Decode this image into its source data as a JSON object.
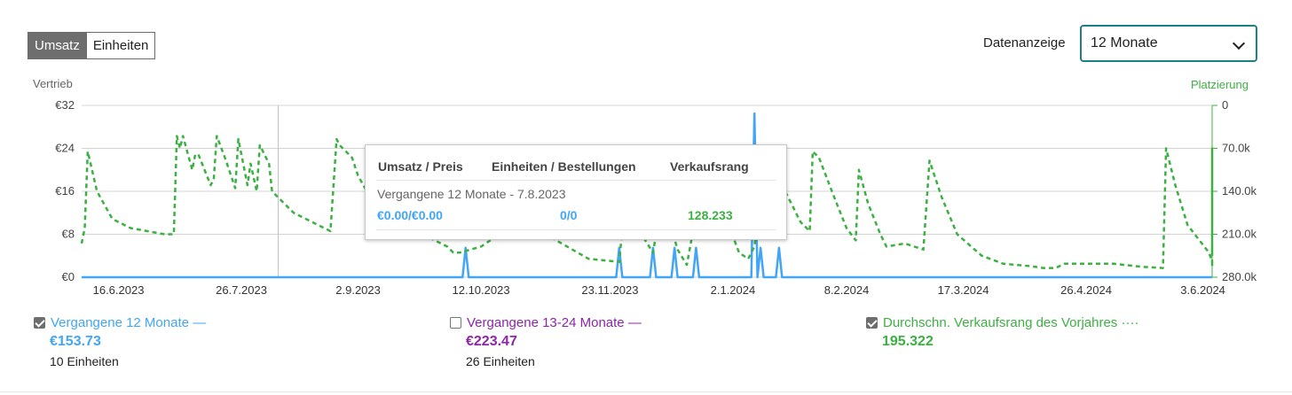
{
  "toggle": {
    "revenue": "Umsatz",
    "units": "Einheiten"
  },
  "range": {
    "label": "Datenanzeige",
    "selected": "12 Monate"
  },
  "chart_data": {
    "type": "line",
    "left_axis_title": "Vertrieb",
    "right_axis_title": "Platzierung",
    "left_ticks": [
      "€0",
      "€8",
      "€16",
      "€24",
      "€32"
    ],
    "right_ticks": [
      "0",
      "70.0k",
      "140.0k",
      "210.0k",
      "280.0k"
    ],
    "ylim": [
      0,
      32
    ],
    "y2lim": [
      280000,
      0
    ],
    "x_range": [
      "2023-06-04",
      "2024-06-06"
    ],
    "x_ticks": [
      "16.6.2023",
      "26.7.2023",
      "2.9.2023",
      "12.10.2023",
      "23.11.2023",
      "2.1.2024",
      "8.2.2024",
      "17.3.2024",
      "26.4.2024",
      "3.6.2024"
    ],
    "x_tick_dates": [
      "2023-06-16",
      "2023-07-26",
      "2023-09-02",
      "2023-10-12",
      "2023-11-23",
      "2024-01-02",
      "2024-02-08",
      "2024-03-17",
      "2024-04-26",
      "2024-06-03"
    ],
    "hover_date": "2023-08-07",
    "grid": true,
    "legend": "bottom",
    "series": [
      {
        "name": "Vergangene 12 Monate",
        "axis": "left",
        "style": "solid",
        "color": "#42a5f5",
        "points": [
          [
            "2023-06-04",
            0
          ],
          [
            "2023-10-06",
            0
          ],
          [
            "2023-10-07",
            5.5
          ],
          [
            "2023-10-08",
            0
          ],
          [
            "2023-11-25",
            0
          ],
          [
            "2023-11-26",
            5.5
          ],
          [
            "2023-11-27",
            0
          ],
          [
            "2023-12-06",
            0
          ],
          [
            "2023-12-07",
            5.5
          ],
          [
            "2023-12-08",
            0
          ],
          [
            "2023-12-13",
            0
          ],
          [
            "2023-12-14",
            5.5
          ],
          [
            "2023-12-15",
            0
          ],
          [
            "2023-12-20",
            0
          ],
          [
            "2023-12-21",
            5.5
          ],
          [
            "2023-12-22",
            0
          ],
          [
            "2024-01-08",
            0
          ],
          [
            "2024-01-09",
            30.5
          ],
          [
            "2024-01-10",
            0
          ],
          [
            "2024-01-11",
            5.5
          ],
          [
            "2024-01-12",
            0
          ],
          [
            "2024-01-16",
            0
          ],
          [
            "2024-01-17",
            5.5
          ],
          [
            "2024-01-18",
            0
          ],
          [
            "2024-06-06",
            0
          ]
        ]
      },
      {
        "name": "Durchschn. Verkaufsrang des Vorjahres",
        "axis": "right",
        "style": "dashed",
        "color": "#3cb043",
        "points": [
          [
            "2023-06-04",
            225000
          ],
          [
            "2023-06-05",
            200000
          ],
          [
            "2023-06-06",
            75000
          ],
          [
            "2023-06-09",
            140000
          ],
          [
            "2023-06-14",
            185000
          ],
          [
            "2023-06-20",
            200000
          ],
          [
            "2023-07-01",
            210000
          ],
          [
            "2023-07-04",
            210000
          ],
          [
            "2023-07-05",
            50000
          ],
          [
            "2023-07-06",
            70000
          ],
          [
            "2023-07-07",
            50000
          ],
          [
            "2023-07-10",
            105000
          ],
          [
            "2023-07-11",
            80000
          ],
          [
            "2023-07-12",
            80000
          ],
          [
            "2023-07-16",
            130000
          ],
          [
            "2023-07-17",
            120000
          ],
          [
            "2023-07-18",
            50000
          ],
          [
            "2023-07-21",
            90000
          ],
          [
            "2023-07-24",
            135000
          ],
          [
            "2023-07-25",
            55000
          ],
          [
            "2023-07-28",
            130000
          ],
          [
            "2023-07-29",
            95000
          ],
          [
            "2023-07-31",
            140000
          ],
          [
            "2023-08-01",
            65000
          ],
          [
            "2023-08-04",
            95000
          ],
          [
            "2023-08-05",
            140000
          ],
          [
            "2023-08-12",
            175000
          ],
          [
            "2023-08-24",
            205000
          ],
          [
            "2023-08-26",
            55000
          ],
          [
            "2023-08-27",
            65000
          ],
          [
            "2023-08-31",
            85000
          ],
          [
            "2023-09-02",
            115000
          ],
          [
            "2023-09-06",
            150000
          ],
          [
            "2023-09-12",
            190000
          ],
          [
            "2023-09-25",
            215000
          ],
          [
            "2023-10-01",
            230000
          ],
          [
            "2023-10-03",
            240000
          ],
          [
            "2023-10-05",
            240000
          ],
          [
            "2023-10-12",
            230000
          ],
          [
            "2023-10-18",
            210000
          ],
          [
            "2023-10-22",
            195000
          ],
          [
            "2023-11-02",
            210000
          ],
          [
            "2023-11-16",
            250000
          ],
          [
            "2023-11-26",
            255000
          ],
          [
            "2023-11-28",
            150000
          ],
          [
            "2023-12-02",
            200000
          ],
          [
            "2023-12-07",
            240000
          ],
          [
            "2023-12-10",
            150000
          ],
          [
            "2023-12-15",
            235000
          ],
          [
            "2023-12-18",
            260000
          ],
          [
            "2023-12-22",
            150000
          ],
          [
            "2023-12-28",
            180000
          ],
          [
            "2024-01-01",
            200000
          ],
          [
            "2024-01-04",
            240000
          ],
          [
            "2024-01-07",
            250000
          ],
          [
            "2024-01-09",
            230000
          ],
          [
            "2024-01-12",
            100000
          ],
          [
            "2024-01-18",
            130000
          ],
          [
            "2024-01-20",
            150000
          ],
          [
            "2024-01-24",
            190000
          ],
          [
            "2024-01-27",
            205000
          ],
          [
            "2024-01-28",
            75000
          ],
          [
            "2024-01-30",
            85000
          ],
          [
            "2024-02-04",
            150000
          ],
          [
            "2024-02-08",
            200000
          ],
          [
            "2024-02-11",
            220000
          ],
          [
            "2024-02-12",
            105000
          ],
          [
            "2024-02-15",
            160000
          ],
          [
            "2024-02-19",
            210000
          ],
          [
            "2024-02-21",
            230000
          ],
          [
            "2024-02-27",
            225000
          ],
          [
            "2024-03-04",
            235000
          ],
          [
            "2024-03-06",
            90000
          ],
          [
            "2024-03-10",
            150000
          ],
          [
            "2024-03-15",
            210000
          ],
          [
            "2024-03-23",
            245000
          ],
          [
            "2024-03-30",
            258000
          ],
          [
            "2024-04-08",
            262000
          ],
          [
            "2024-04-12",
            265000
          ],
          [
            "2024-04-16",
            265000
          ],
          [
            "2024-04-19",
            258000
          ],
          [
            "2024-04-30",
            258000
          ],
          [
            "2024-05-05",
            258000
          ],
          [
            "2024-05-14",
            263000
          ],
          [
            "2024-05-21",
            265000
          ],
          [
            "2024-05-22",
            70000
          ],
          [
            "2024-05-25",
            130000
          ],
          [
            "2024-05-29",
            195000
          ],
          [
            "2024-06-05",
            240000
          ],
          [
            "2024-06-12",
            255000
          ],
          [
            "2024-06-18",
            260000
          ],
          [
            "2024-06-21",
            263000
          ],
          [
            "2024-06-22",
            70000
          ],
          [
            "2024-06-25",
            130000
          ],
          [
            "2024-06-30",
            210000
          ],
          [
            "2024-07-06",
            240000
          ]
        ]
      }
    ]
  },
  "tooltip": {
    "headers": [
      "Umsatz / Preis",
      "Einheiten / Bestellungen",
      "Verkaufsrang"
    ],
    "subtitle": "Vergangene 12 Monate - 7.8.2023",
    "revenue_price": "€0.00/€0.00",
    "units_orders": "0/0",
    "rank": "128.233"
  },
  "legend": [
    {
      "label": "Vergangene 12 Monate",
      "marker": "—",
      "checked": true,
      "total": "€153.73",
      "units": "10 Einheiten",
      "color": "#42a5f5"
    },
    {
      "label": "Vergangene 13-24 Monate",
      "marker": "—",
      "checked": false,
      "total": "€223.47",
      "units": "26 Einheiten",
      "color": "#8e24aa"
    },
    {
      "label": "Durchschn. Verkaufsrang des Vorjahres",
      "marker": "····",
      "checked": true,
      "total": "195.322",
      "units": "",
      "color": "#3cb043"
    }
  ]
}
